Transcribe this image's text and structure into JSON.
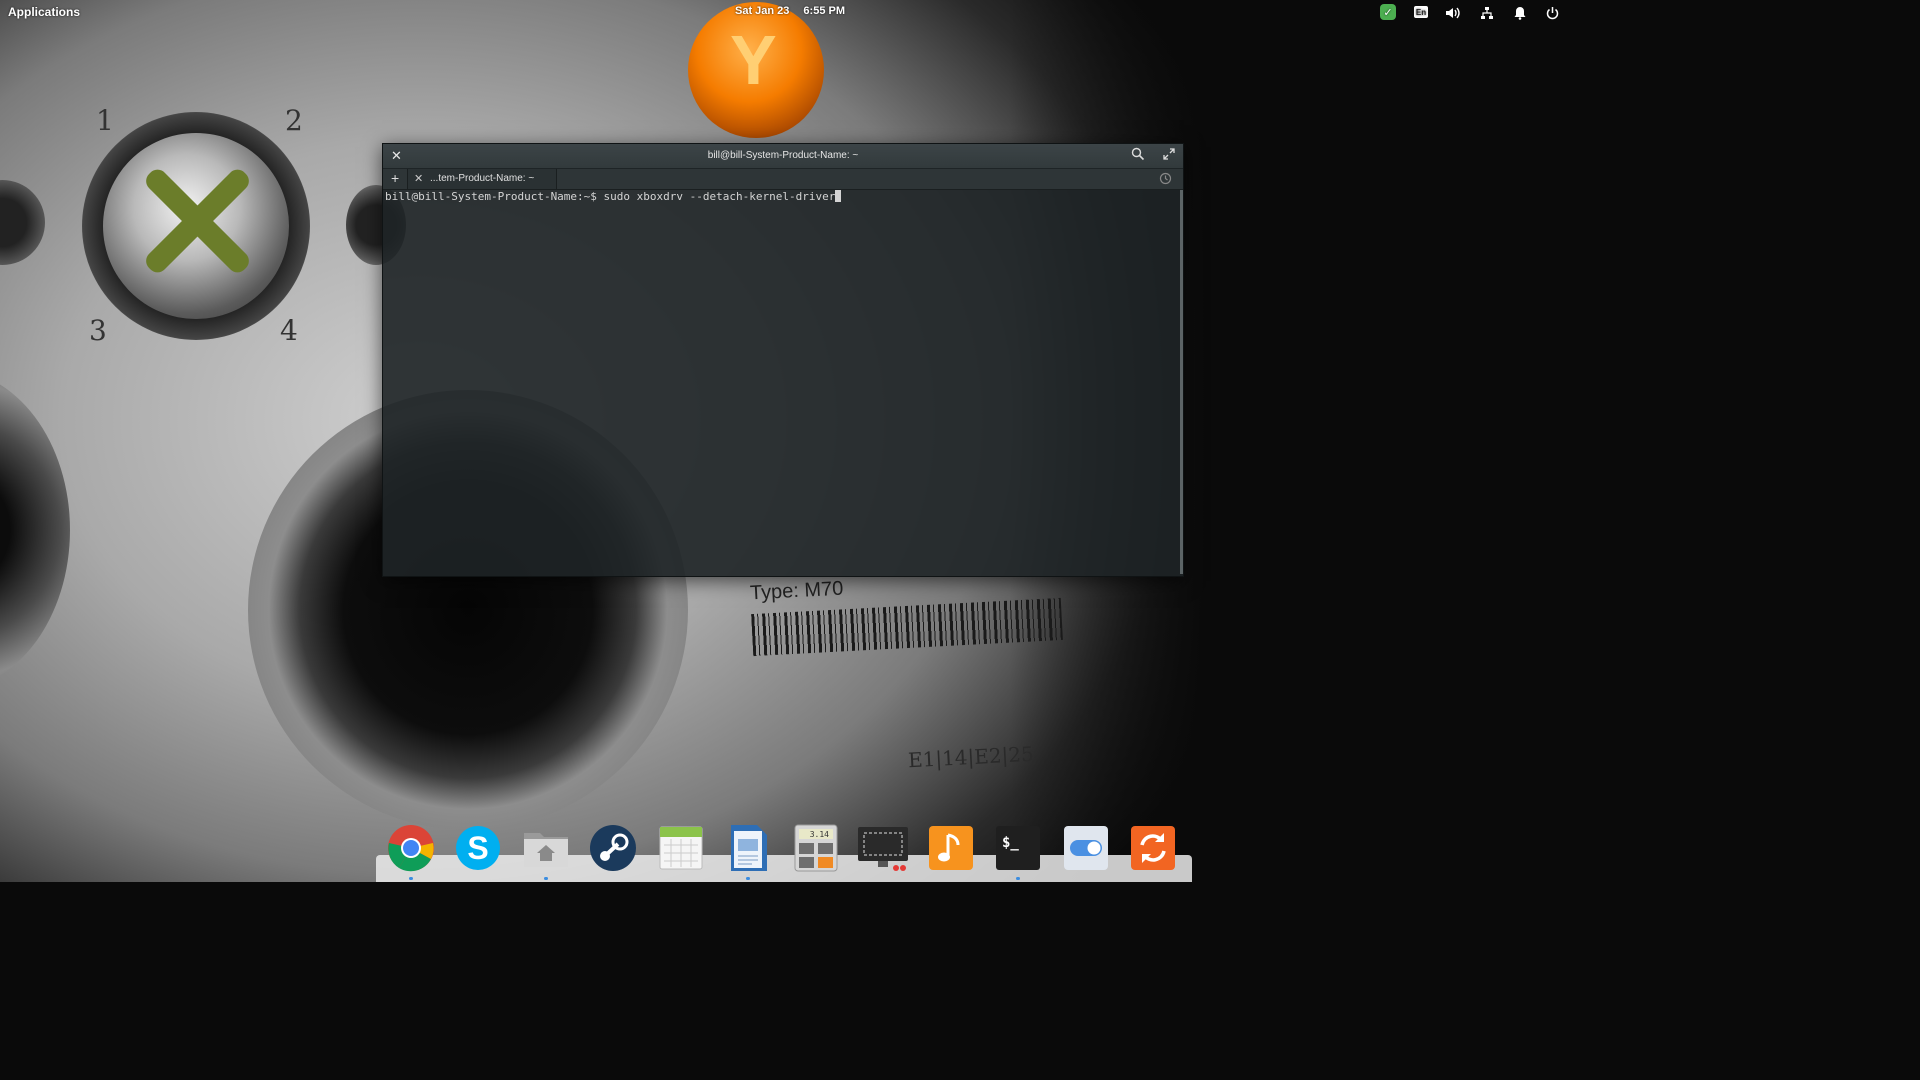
{
  "top_panel": {
    "applications_label": "Applications",
    "date": "Sat Jan 23",
    "time": "6:55 PM",
    "tray": {
      "update_icon": "check-shield-icon",
      "keyboard_layout": "En",
      "volume_icon": "volume-icon",
      "network_icon": "network-icon",
      "notifications_icon": "bell-icon",
      "power_icon": "power-icon",
      "accent_color": "#4caf50"
    }
  },
  "wallpaper": {
    "stick_numbers": [
      "1",
      "2",
      "3",
      "4"
    ],
    "y_button_letter": "Y",
    "label_type": "Type: M70",
    "label_code": "E1|14|E2|25"
  },
  "terminal": {
    "title": "bill@bill-System-Product-Name: ~",
    "tab_label": "...tem-Product-Name: ~",
    "prompt": "bill@bill-System-Product-Name:~$ ",
    "command": "sudo xboxdrv --detach-kernel-driver",
    "icons": [
      "close-icon",
      "search-icon",
      "maximize-icon",
      "add-tab-icon",
      "history-icon"
    ]
  },
  "dock": {
    "apps": [
      {
        "name": "Google Chrome",
        "icon": "chrome-icon",
        "running": true
      },
      {
        "name": "Skype",
        "icon": "skype-icon",
        "running": false
      },
      {
        "name": "Files",
        "icon": "home-folder-icon",
        "running": true
      },
      {
        "name": "Steam",
        "icon": "steam-icon",
        "running": false
      },
      {
        "name": "Calendar",
        "icon": "calendar-icon",
        "running": false
      },
      {
        "name": "Document Viewer",
        "icon": "document-icon",
        "running": true
      },
      {
        "name": "Calculator",
        "icon": "calculator-icon",
        "running": false
      },
      {
        "name": "Screenshot",
        "icon": "screenshot-icon",
        "running": false
      },
      {
        "name": "Music",
        "icon": "music-icon",
        "running": false
      },
      {
        "name": "Terminal",
        "icon": "terminal-icon",
        "running": true
      },
      {
        "name": "System Settings",
        "icon": "toggle-icon",
        "running": false
      },
      {
        "name": "Software Update",
        "icon": "update-icon",
        "running": false
      }
    ],
    "calculator_display": "3.14",
    "terminal_glyph": "$_"
  }
}
